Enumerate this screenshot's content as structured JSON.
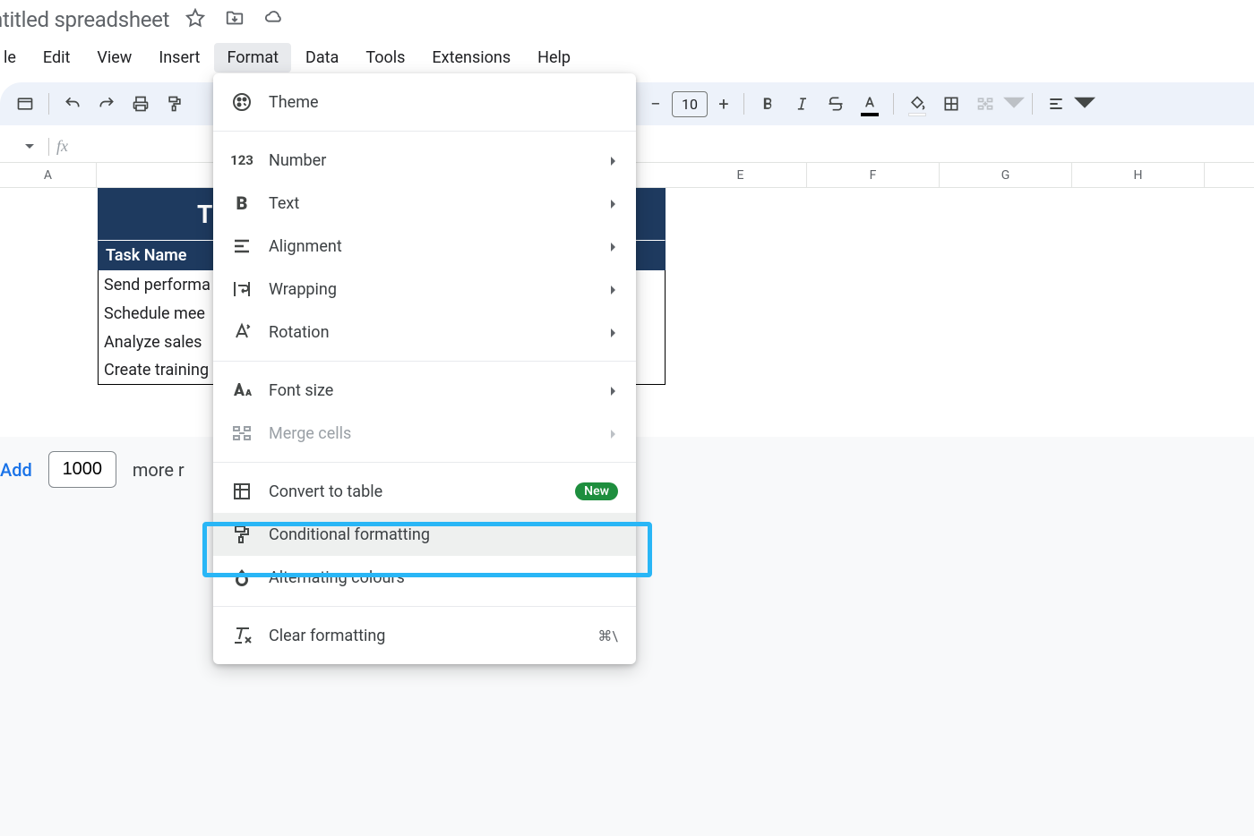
{
  "doc_title": "ntitled spreadsheet",
  "menu": {
    "file": "le",
    "edit": "Edit",
    "view": "View",
    "insert": "Insert",
    "format": "Format",
    "data": "Data",
    "tools": "Tools",
    "extensions": "Extensions",
    "help": "Help"
  },
  "toolbar": {
    "font_size": "10"
  },
  "columns": [
    "A",
    "E",
    "F",
    "G",
    "H"
  ],
  "table": {
    "title_fragment": "T",
    "header": "Task Name",
    "rows": [
      "Send performa",
      "Schedule mee",
      "Analyze sales",
      "Create training"
    ]
  },
  "add_rows": {
    "link": "Add",
    "count": "1000",
    "more": "more r"
  },
  "dropdown": {
    "theme": "Theme",
    "number": "Number",
    "text": "Text",
    "alignment": "Alignment",
    "wrapping": "Wrapping",
    "rotation": "Rotation",
    "font_size": "Font size",
    "merge_cells": "Merge cells",
    "convert_to_table": "Convert to table",
    "new_badge": "New",
    "conditional_formatting": "Conditional formatting",
    "alternating_colours": "Alternating colours",
    "clear_formatting": "Clear formatting",
    "clear_shortcut": "⌘\\"
  }
}
